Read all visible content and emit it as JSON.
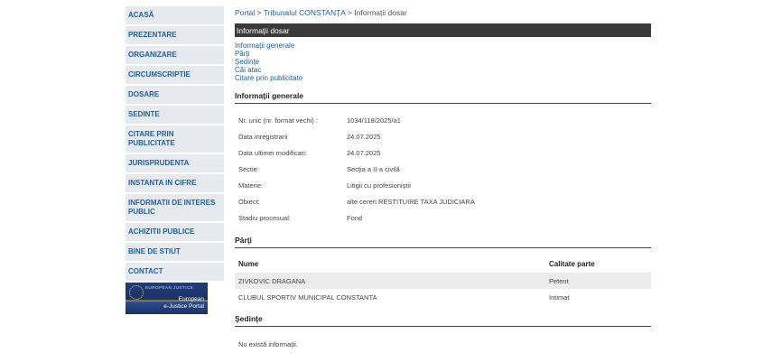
{
  "sidebar": {
    "items": [
      {
        "label": "ACASĂ"
      },
      {
        "label": "PREZENTARE"
      },
      {
        "label": "ORGANIZARE"
      },
      {
        "label": "CIRCUMSCRIPTIE"
      },
      {
        "label": "DOSARE"
      },
      {
        "label": "SEDINTE"
      },
      {
        "label": "CITARE PRIN PUBLICITATE"
      },
      {
        "label": "JURISPRUDENTA"
      },
      {
        "label": "INSTANTA IN CIFRE"
      },
      {
        "label": "INFORMATII DE INTERES PUBLIC"
      },
      {
        "label": "ACHIZITII PUBLICE"
      },
      {
        "label": "BINE DE STIUT"
      },
      {
        "label": "CONTACT"
      }
    ],
    "ejustice": {
      "small": "EUROPEAN JUSTICE",
      "line1": "European",
      "line2": "e-Justice Portal"
    }
  },
  "breadcrumb": {
    "portal": "Portal",
    "sep1": ">",
    "court": "Tribunalul CONSTANȚA",
    "sep2": ">",
    "current": "Informații dosar"
  },
  "header": {
    "title": "Informaţii dosar"
  },
  "links": [
    "Informaţii generale",
    "Părţi",
    "Şedinţe",
    "Căi atac",
    "Citare prin publicitate"
  ],
  "general": {
    "title": "Informaţii generale",
    "rows": [
      {
        "label": "Nr. unic (nr. format vechi) :",
        "value": "1034/118/2025/a1"
      },
      {
        "label": "Data inregistrarii",
        "value": "24.07.2025"
      },
      {
        "label": "Data ultimei modificari:",
        "value": "24.07.2025"
      },
      {
        "label": "Sectie:",
        "value": "Secţia a II-a civilă"
      },
      {
        "label": "Materie:",
        "value": "Litigii cu profesioniştii"
      },
      {
        "label": "Obiect:",
        "value": "alte cereri RESTITUIRE TAXA JUDICIARA"
      },
      {
        "label": "Stadiu procesual:",
        "value": "Fond"
      }
    ]
  },
  "parties": {
    "title": "Părţi",
    "headers": {
      "name": "Nume",
      "role": "Calitate parte"
    },
    "rows": [
      {
        "name": "ZIVKOVIC DRAGANA",
        "role": "Petent"
      },
      {
        "name": "CLUBUL SPORTIV MUNICIPAL CONSTANTA",
        "role": "Intimat"
      }
    ]
  },
  "hearings": {
    "title": "Şedinţe",
    "empty": "Nu există informaţii."
  }
}
